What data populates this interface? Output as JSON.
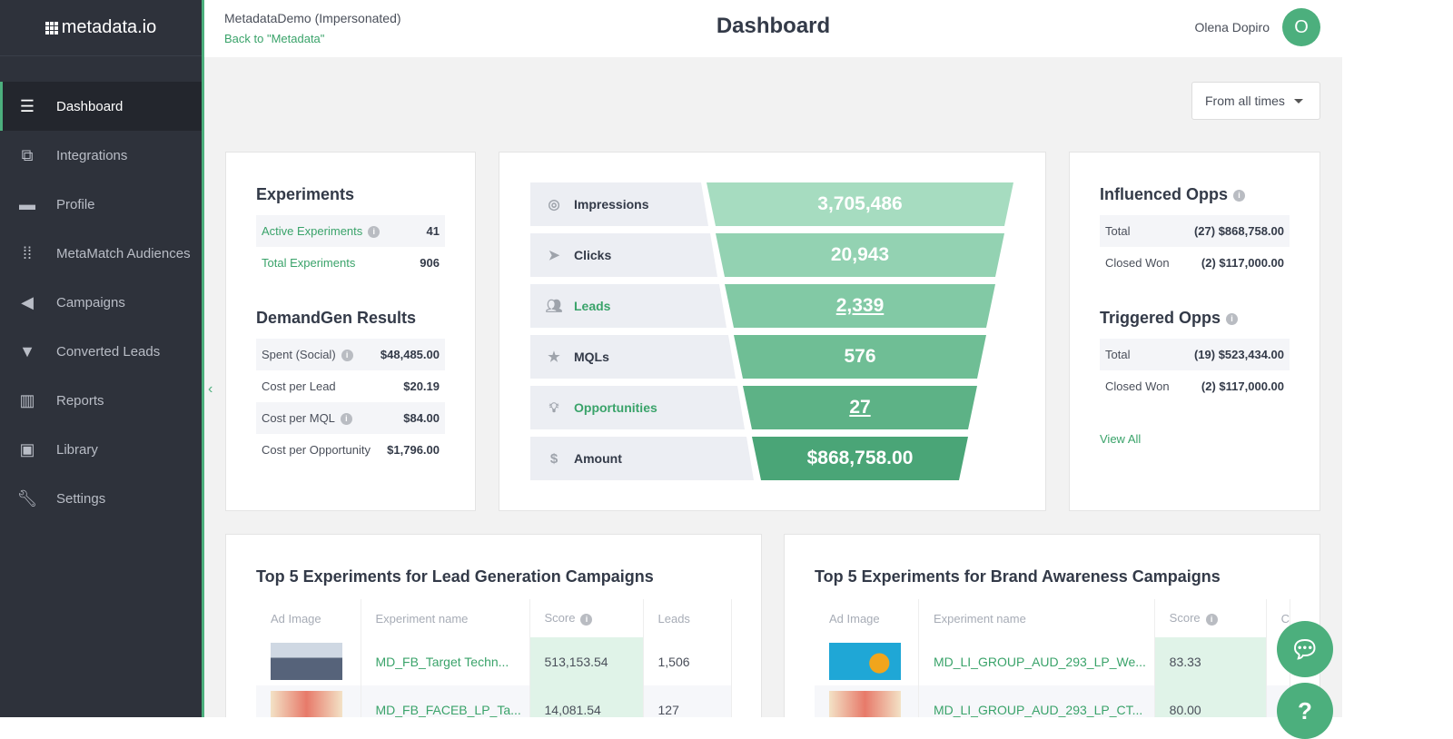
{
  "app": {
    "logo": "metadata.io"
  },
  "header": {
    "impersonation": "MetadataDemo (Impersonated)",
    "back_link": "Back to \"Metadata\"",
    "title": "Dashboard",
    "user_name": "Olena Dopiro",
    "avatar_initial": "O"
  },
  "sidebar": {
    "items": [
      {
        "label": "Dashboard",
        "icon": "database-icon"
      },
      {
        "label": "Integrations",
        "icon": "copy-icon"
      },
      {
        "label": "Profile",
        "icon": "folder-icon"
      },
      {
        "label": "MetaMatch Audiences",
        "icon": "sliders-icon"
      },
      {
        "label": "Campaigns",
        "icon": "megaphone-icon"
      },
      {
        "label": "Converted Leads",
        "icon": "filter-icon"
      },
      {
        "label": "Reports",
        "icon": "bar-chart-icon"
      },
      {
        "label": "Library",
        "icon": "image-icon"
      },
      {
        "label": "Settings",
        "icon": "wrench-icon"
      }
    ]
  },
  "filter": {
    "date_range": "From all times"
  },
  "experiments": {
    "title": "Experiments",
    "active_label": "Active Experiments",
    "active_value": "41",
    "total_label": "Total Experiments",
    "total_value": "906"
  },
  "demandgen": {
    "title": "DemandGen Results",
    "rows": [
      {
        "label": "Spent (Social)",
        "value": "$48,485.00"
      },
      {
        "label": "Cost per Lead",
        "value": "$20.19"
      },
      {
        "label": "Cost per MQL",
        "value": "$84.00"
      },
      {
        "label": "Cost per Opportunity",
        "value": "$1,796.00"
      }
    ]
  },
  "funnel": [
    {
      "label": "Impressions",
      "value": "3,705,486",
      "color": "#a6dcc0"
    },
    {
      "label": "Clicks",
      "value": "20,943",
      "color": "#93d2b2"
    },
    {
      "label": "Leads",
      "value": "2,339",
      "color": "#82c9a5"
    },
    {
      "label": "MQLs",
      "value": "576",
      "color": "#6fbe95"
    },
    {
      "label": "Opportunities",
      "value": "27",
      "color": "#5db286"
    },
    {
      "label": "Amount",
      "value": "$868,758.00",
      "color": "#4aa577"
    }
  ],
  "influenced": {
    "title": "Influenced Opps",
    "total_label": "Total",
    "total_value": "(27) $868,758.00",
    "won_label": "Closed Won",
    "won_value": "(2) $117,000.00"
  },
  "triggered": {
    "title": "Triggered Opps",
    "total_label": "Total",
    "total_value": "(19) $523,434.00",
    "won_label": "Closed Won",
    "won_value": "(2) $117,000.00",
    "view_all": "View All"
  },
  "lead_table": {
    "title": "Top 5 Experiments for Lead Generation Campaigns",
    "headers": [
      "Ad Image",
      "Experiment name",
      "Score",
      "Leads"
    ],
    "rows": [
      {
        "name": "MD_FB_Target Techn...",
        "score": "513,153.54",
        "leads": "1,506"
      },
      {
        "name": "MD_FB_FACEB_LP_Ta...",
        "score": "14,081.54",
        "leads": "127"
      }
    ]
  },
  "brand_table": {
    "title": "Top 5 Experiments for Brand Awareness Campaigns",
    "headers": [
      "Ad Image",
      "Experiment name",
      "Score",
      "C"
    ],
    "rows": [
      {
        "name": "MD_LI_GROUP_AUD_293_LP_We...",
        "score": "83.33"
      },
      {
        "name": "MD_LI_GROUP_AUD_293_LP_CT...",
        "score": "80.00"
      }
    ]
  },
  "colors": {
    "accent": "#4caf7d",
    "sidebar": "#2e323b"
  }
}
